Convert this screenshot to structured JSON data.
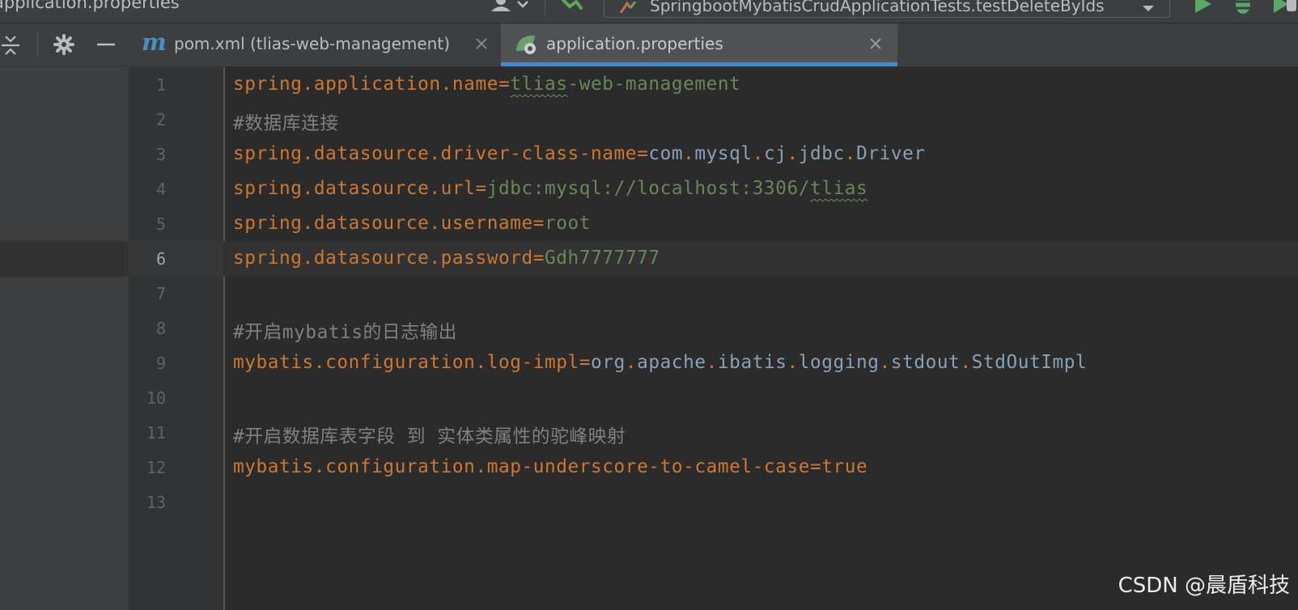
{
  "topbar": {
    "breadcrumb": "application.properties",
    "run_config": "SpringbootMybatisCrudApplicationTests.testDeleteByIds",
    "icons": [
      "user-icon",
      "hammer-icon",
      "chevron-down-icon",
      "run-icon",
      "debug-icon",
      "coverage-icon"
    ]
  },
  "toolstrip": {
    "icons": [
      "collapse-all-icon",
      "gear-icon",
      "minimize-icon"
    ]
  },
  "tabs": [
    {
      "label": "pom.xml (tlias-web-management)",
      "icon": "maven-icon",
      "active": false
    },
    {
      "label": "application.properties",
      "icon": "spring-properties-icon",
      "active": true
    }
  ],
  "editor": {
    "current_line": 6,
    "lines": [
      {
        "num": "1",
        "key": "spring.application.name",
        "eq": "=",
        "value": "tlias-web-management"
      },
      {
        "num": "2",
        "comment": "#数据库连接"
      },
      {
        "num": "3",
        "key": "spring.datasource.driver-class-name",
        "eq": "=",
        "value": "com.mysql.cj.jdbc.Driver"
      },
      {
        "num": "4",
        "key": "spring.datasource.url",
        "eq": "=",
        "value": "jdbc:mysql://localhost:3306/tlias"
      },
      {
        "num": "5",
        "key": "spring.datasource.username",
        "eq": "=",
        "value": "root"
      },
      {
        "num": "6",
        "key": "spring.datasource.password",
        "eq": "=",
        "value": "Gdh7777777"
      },
      {
        "num": "7"
      },
      {
        "num": "8",
        "comment": "#开启mybatis的日志输出"
      },
      {
        "num": "9",
        "key": "mybatis.configuration.log-impl",
        "eq": "=",
        "value": "org.apache.ibatis.logging.stdout.StdOutImpl"
      },
      {
        "num": "10"
      },
      {
        "num": "11",
        "comment": "#开启数据库表字段 到 实体类属性的驼峰映射"
      },
      {
        "num": "12",
        "key": "mybatis.configuration.map-underscore-to-camel-case",
        "eq": "=",
        "value": "true"
      },
      {
        "num": "13"
      }
    ]
  },
  "watermark": "CSDN @晨盾科技",
  "colors": {
    "editor_bg": "#2b2b2b",
    "panel_bg": "#3c3f41",
    "key": "#cc7832",
    "value": "#6a8759",
    "comment": "#808080",
    "line_number": "#606366",
    "active_tab_underline": "#4a88c7"
  }
}
